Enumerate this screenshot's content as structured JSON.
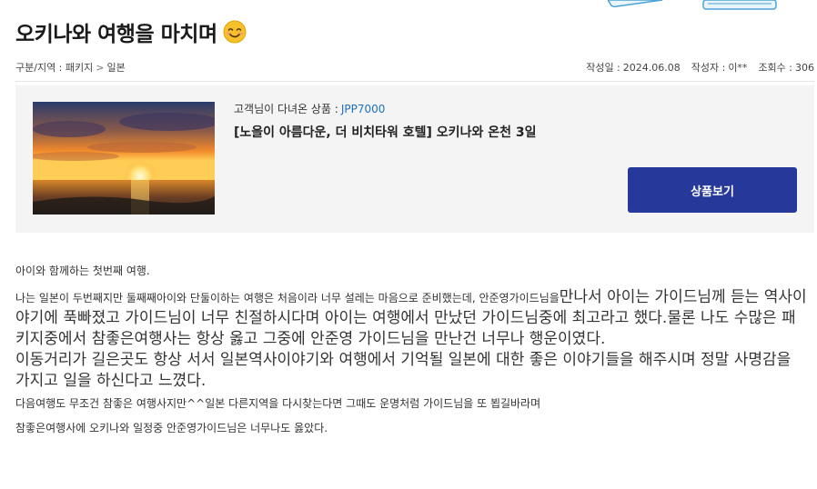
{
  "post": {
    "title": "오키나와 여행을 마치며",
    "title_emoji_icon": "smiling-face-icon",
    "breadcrumb": {
      "category_label": "구분/지역 : 패키지",
      "separator": ">",
      "region": "일본"
    },
    "date_label": "작성일 :",
    "date": "2024.06.08",
    "author_label": "작성자 :",
    "author": "이**",
    "views_label": "조회수 :",
    "views": "306"
  },
  "product": {
    "code_label": "고객님이 다녀온 상품 :",
    "code": "JPP7000",
    "name": "[노을이 아름다운, 더 비치타워 호텔] 오키나와 온천 3일",
    "button_label": "상품보기",
    "thumbnail_icon": "sunset-photo"
  },
  "content": {
    "line1": "아이와 함께하는 첫번째 여행.",
    "line2_small": "나는 일본이 두번째지만 둘째째아이와 단둘이하는 여행은 처음이라 너무 설레는 마음으로 준비했는데, 안준영가이드님을",
    "line2_large": "만나서 아이는 가이드님께 듣는 역사이야기에 푹빠졌고 가이드님이 너무 친절하시다며 아이는 여행에서 만났던 가이드님중에 최고라고 했다.물론 나도 수많은 패키지중에서 참좋은여행사는 항상 옳고 그중에 안준영 가이드님을 만난건 너무나 행운이였다.",
    "line3_large": "이동거리가 길은곳도 항상 서서 일본역사이야기와 여행에서 기억될 일본에 대한 좋은 이야기들을 해주시며 정말 사명감을 가지고 일을 하신다고 느꼈다.",
    "line4": "다음여행도 무조건 참좋은 여행사지만^^일본 다른지역을 다시찾는다면 그때도 운명처럼 가이드님을 또 뵙길바라며",
    "line5": "참좋은여행사에 오키나와 일정중 안준영가이드님은 너무나도 옳았다."
  }
}
